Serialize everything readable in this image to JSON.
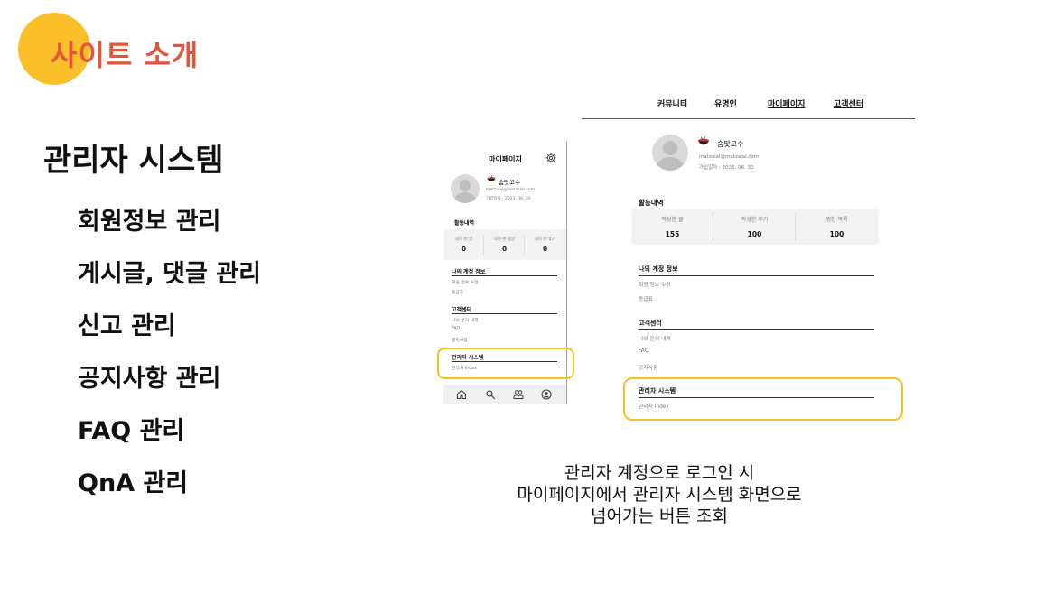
{
  "slide": {
    "title": "사이트 소개",
    "accent_color": "#fbbf2a",
    "title_color": "#e2553a"
  },
  "outline": {
    "heading": "관리자 시스템",
    "features": [
      "회원정보 관리",
      "게시글, 댓글 관리",
      "신고 관리",
      "공지사항 관리",
      "FAQ 관리",
      "QnA 관리"
    ]
  },
  "mobile": {
    "title": "마이페이지",
    "gear_icon": "gear-icon",
    "nickname": "숨맛고수",
    "email": "matzalal@matzalal.com",
    "joined": "가입일자 : 2023. 06. 30",
    "activity_title": "활동내역",
    "stats": [
      {
        "label": "내가 쓴 글",
        "value": "0"
      },
      {
        "label": "내가 쓴 댓글",
        "value": "0"
      },
      {
        "label": "내가 쓴 후기",
        "value": "0"
      }
    ],
    "account_title": "나의 계정 정보",
    "account_items": [
      "회원 정보 수정",
      "등급표"
    ],
    "support_title": "고객센터",
    "support_items": [
      "나의 문의 내역",
      "FAQ",
      "공지사항"
    ],
    "admin_title": "관리자 시스템",
    "admin_items": [
      "관리자 Index"
    ],
    "tab_icons": [
      "home-icon",
      "search-icon",
      "community-icon",
      "profile-icon"
    ]
  },
  "desktop": {
    "nav": [
      "커뮤니티",
      "유명인",
      "마이페이지",
      "고객센터"
    ],
    "nickname": "숨맛고수",
    "email": "matzalal@matzalal.com",
    "joined": "가입일자 : 2023. 06. 30",
    "activity_title": "활동내역",
    "stats": [
      {
        "label": "작성한 글",
        "value": "155"
      },
      {
        "label": "작성한 후기",
        "value": "100"
      },
      {
        "label": "찜한 목록",
        "value": "100"
      }
    ],
    "account_title": "나의 계정 정보",
    "account_items": [
      "회원 정보 수정",
      "등급표"
    ],
    "support_title": "고객센터",
    "support_items": [
      "나의 문의 내역",
      "FAQ",
      "공지사항"
    ],
    "admin_title": "관리자 시스템",
    "admin_items": [
      "관리자 Index"
    ],
    "highlight_color": "#f5c02c"
  },
  "caption": {
    "lines": [
      "관리자 계정으로 로그인 시",
      "마이페이지에서 관리자 시스템 화면으로",
      "넘어가는 버튼 조회"
    ]
  }
}
